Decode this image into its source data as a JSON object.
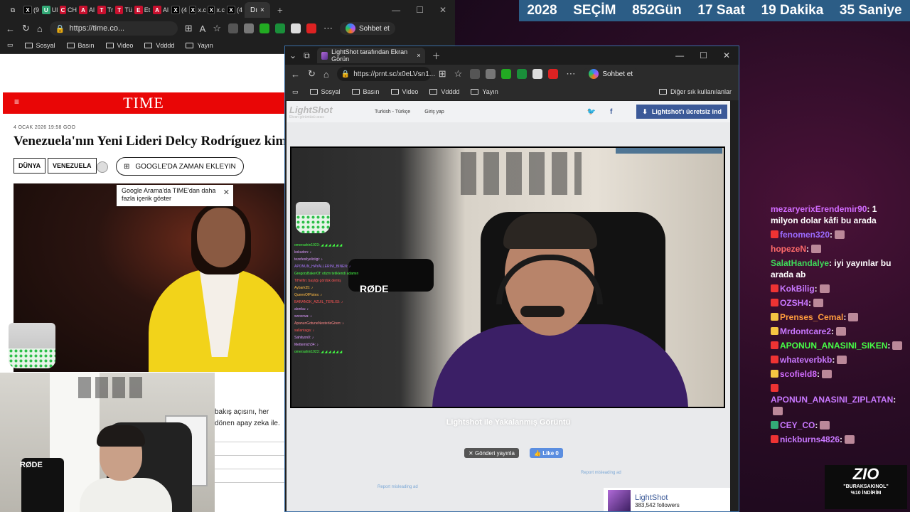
{
  "countdown": {
    "items": [
      "2028",
      "SEÇİM",
      "852Gün",
      "17 Saat",
      "19 Dakika",
      "35 Saniye"
    ]
  },
  "back_browser": {
    "tabs": [
      "(9",
      "Ul",
      "CH",
      "Al",
      "Tr",
      "Tü",
      "Et",
      "Al",
      "(4",
      "x.c",
      "x.c",
      "(4"
    ],
    "active_tab": "Dı",
    "address": "https://time.co...",
    "copilot_label": "Sohbet et",
    "bookmarks": [
      "Sosyal",
      "Basın",
      "Video",
      "Vdddd",
      "Yayın"
    ],
    "bookmarks_more": "Diğer sık kullanılanlar"
  },
  "time_page": {
    "logo": "TIME",
    "menu_icon": "≡",
    "date": "4 OCAK 2026 19:58 GOO",
    "headline": "Venezuela'nın Yeni Lideri Delcy Rodríguez kimd",
    "tag_world": "DÜNYA",
    "tag_venezuela": "VENEZUELA",
    "google_button": "GOOGLE'DA ZAMAN EKLEYIN",
    "tooltip_text": "Google Arama'da TIME'dan daha fazla içerik göster",
    "body_text": "bakış açısını, her dönen apay zeka ile."
  },
  "front_browser": {
    "tab_title": "LightShot tarafından Ekran Görün",
    "address": "https://prnt.sc/x0eLVsn1...",
    "copilot_label": "Sohbet et",
    "bookmarks": [
      "Sosyal",
      "Basın",
      "Video",
      "Vdddd",
      "Yayın"
    ],
    "bookmarks_more": "Diğer sık kullanılanlar"
  },
  "lightshot": {
    "logo": "LightShot",
    "logo_sub": "Ekran görüntüsü aracı",
    "language": "Turkish - Türkçe",
    "login": "Giriş yap",
    "cta": "Lightshot'ı ücretsiz ind",
    "caption": "Lightshot ile Yakalanmış Görüntü",
    "tweet": "Gönderi yayınla",
    "like": "Like 0",
    "report": "Report misleading ad",
    "follow_name": "LightShot",
    "follow_count": "383,542 followers",
    "shot_mic": "RØDE",
    "shot_chat": [
      "omersahin1923: ◢ ◢ ◢ ◢ ◢ ◢",
      "kokudon: ♪",
      "tezefesilyeliciigi: ♪",
      "APONUN_HAYALLERINI_BINEN: ♪",
      "GregoryBakerOf: otizm tetiklendi adamın",
      "TiHelfin: başlığı gördük demiş",
      "Aybark35: ♪",
      "QueenOfPistes: ♪",
      "BARANOK_AZUIL_TERLISI: ♪",
      "alonka: ♪",
      "xwoxrwa: ♪",
      "ApanunGotuneNesterleGiren: ♪",
      "sallantaga: ♪",
      "Sahilyon0: ♪",
      "Mettemich34: ♪",
      "omersahin1923: ◢ ◢ ◢ ◢ ◢ ◢"
    ]
  },
  "webcam": {
    "mic_label": "RØDE"
  },
  "chat": [
    {
      "user": "mezaryerixErendemir90",
      "color": "#d26cff",
      "text": "1 milyon dolar kâfi bu arada",
      "badge": ""
    },
    {
      "user": "fenomen320",
      "color": "#9b6bff",
      "text": "",
      "badge": "#e33"
    },
    {
      "user": "hopezeN",
      "color": "#ff6a6a",
      "text": "",
      "badge": "#e33"
    },
    {
      "user": "SalatHandalye",
      "color": "#3fd95a",
      "text": "iyi yayınlar bu arada ab",
      "badge": ""
    },
    {
      "user": "KokBilig",
      "color": "#c978ff",
      "text": "",
      "badge": "#e33"
    },
    {
      "user": "OZSH4",
      "color": "#c978ff",
      "text": "",
      "badge": "#e33"
    },
    {
      "user": "Prenses_Cemal",
      "color": "#ff9b3d",
      "text": "",
      "badge": "#f5c542"
    },
    {
      "user": "Mrdontcare2",
      "color": "#c978ff",
      "text": "",
      "badge": "#f5c542"
    },
    {
      "user": "APONUN_ANASINI_SIKEN",
      "color": "#46ff46",
      "text": "",
      "badge": "#e33"
    },
    {
      "user": "whateverbkb",
      "color": "#c978ff",
      "text": "",
      "badge": "#e33"
    },
    {
      "user": "scofield8",
      "color": "#d26cff",
      "text": "",
      "badge": "#f5c542"
    },
    {
      "user": "APONUN_ANASINI_ZIPLATAN",
      "color": "#c978ff",
      "text": "",
      "badge": "#e33"
    },
    {
      "user": "CEY_CO",
      "color": "#c978ff",
      "text": "",
      "badge": "#3a7"
    },
    {
      "user": "nickburns4826",
      "color": "#c978ff",
      "text": "",
      "badge": "#e33"
    }
  ],
  "promo": {
    "brand": "ZIO",
    "code_line": "\"BURAKSAKINOL\"",
    "discount": "%10 İNDİRİM"
  }
}
